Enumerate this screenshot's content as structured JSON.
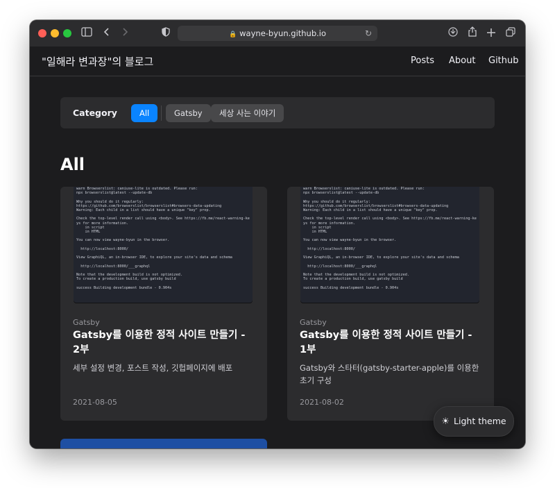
{
  "browser": {
    "url": "wayne-byun.github.io",
    "icons": [
      "sidebar-icon",
      "back-icon",
      "forward-icon",
      "shield-icon",
      "lock-icon",
      "reload-icon",
      "download-icon",
      "share-icon",
      "new-tab-icon",
      "tabs-icon"
    ]
  },
  "header": {
    "title": "\"일해라 변과장\"의 블로그",
    "nav": [
      "Posts",
      "About",
      "Github"
    ]
  },
  "category": {
    "label": "Category",
    "items": [
      {
        "label": "All",
        "active": true
      },
      {
        "label": "Gatsby",
        "active": false
      },
      {
        "label": "세상 사는 이야기",
        "active": false
      }
    ]
  },
  "section_title": "All",
  "terminal_text": "warn Browserslist: caniuse-lite is outdated. Please run:\nnpx browserslist@latest --update-db\n\nWhy you should do it regularly:\nhttps://github.com/browserslist/browserslist#browsers-data-updating\nWarning: Each child in a list should have a unique \"key\" prop.\n\nCheck the top-level render call using <body>. See https://fb.me/react-warning-ke\nys for more information.\n    in script\n    in HTML\n\nYou can now view wayne-byun in the browser.\n\n  http://localhost:8000/\n\nView GraphiQL, an in-browser IDE, to explore your site's data and schema\n\n  http://localhost:8000/___graphql\n\nNote that the development build is not optimized.\nTo create a production build, use gatsby build\n\nsuccess Building development bundle - 0.904s",
  "posts": [
    {
      "category": "Gatsby",
      "title": "Gatsby를 이용한 정적 사이트 만들기 - 2부",
      "description": "세부 설정 변경, 포스트 작성, 깃헙페이지에 배포",
      "date": "2021-08-05"
    },
    {
      "category": "Gatsby",
      "title": "Gatsby를 이용한 정적 사이트 만들기 - 1부",
      "description": "Gatsby와 스타터(gatsby-starter-apple)를 이용한 초기 구성",
      "date": "2021-08-02"
    }
  ],
  "theme_toggle": {
    "label": "Light theme",
    "icon": "sun-icon"
  },
  "colors": {
    "accent": "#0a84ff",
    "background": "#1c1c1e",
    "card": "#2c2c2e"
  }
}
